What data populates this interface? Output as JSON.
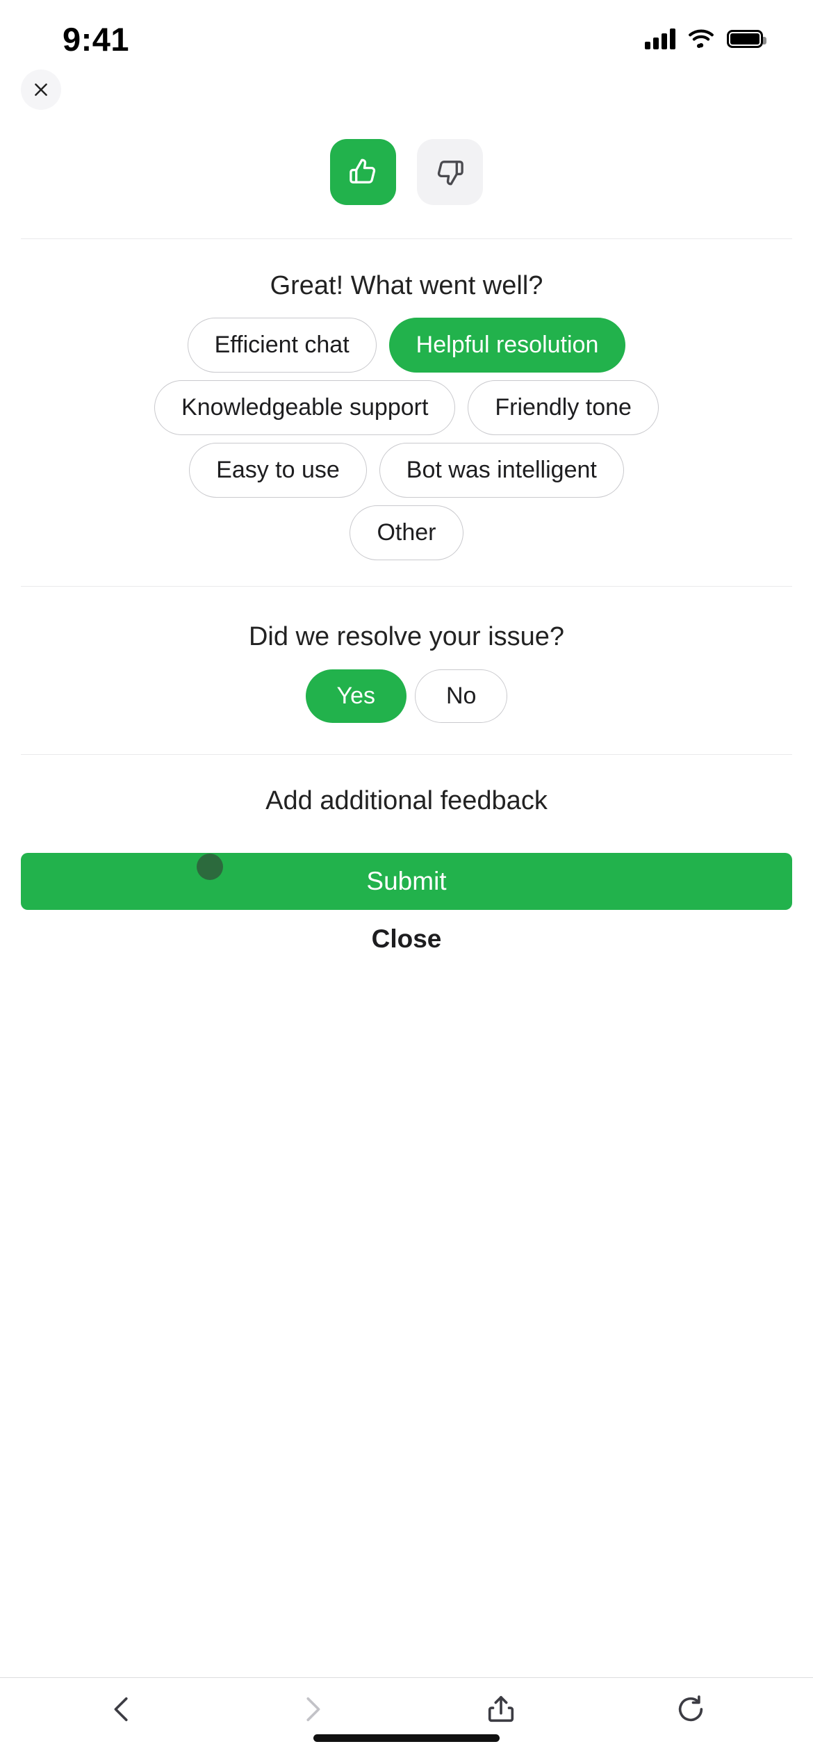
{
  "status_bar": {
    "time": "9:41",
    "icons": [
      "cellular-signal-icon",
      "wifi-icon",
      "battery-icon"
    ]
  },
  "header": {
    "close_icon": "close-x-icon"
  },
  "rating": {
    "thumbs_up": {
      "icon": "thumbs-up-icon",
      "label": "Thumbs up",
      "selected": true,
      "color": "#22B24C"
    },
    "thumbs_down": {
      "icon": "thumbs-down-icon",
      "label": "Thumbs down",
      "selected": false,
      "color": "#F2F2F4"
    }
  },
  "positive_feedback": {
    "question": "Great! What went well?",
    "rows": [
      [
        {
          "label": "Efficient chat",
          "selected": false
        },
        {
          "label": "Helpful resolution",
          "selected": true
        }
      ],
      [
        {
          "label": "Knowledgeable support",
          "selected": false
        },
        {
          "label": "Friendly tone",
          "selected": false
        }
      ],
      [
        {
          "label": "Easy to use",
          "selected": false
        },
        {
          "label": "Bot was intelligent",
          "selected": false
        }
      ],
      [
        {
          "label": "Other",
          "selected": false
        }
      ]
    ]
  },
  "resolution": {
    "question": "Did we resolve your issue?",
    "options": [
      {
        "label": "Yes",
        "selected": true
      },
      {
        "label": "No",
        "selected": false
      }
    ]
  },
  "additional": {
    "label": "Add additional feedback"
  },
  "actions": {
    "submit_label": "Submit",
    "close_label": "Close"
  },
  "browser_toolbar": {
    "items": [
      {
        "name": "back-icon",
        "enabled": true
      },
      {
        "name": "forward-icon",
        "enabled": false
      },
      {
        "name": "share-icon",
        "enabled": true
      },
      {
        "name": "reload-icon",
        "enabled": true
      }
    ]
  },
  "theme": {
    "accent": "#22B24C",
    "chip_border": "#C9C9CD",
    "divider": "#E9E9EB",
    "text": "#1D1D1F"
  }
}
